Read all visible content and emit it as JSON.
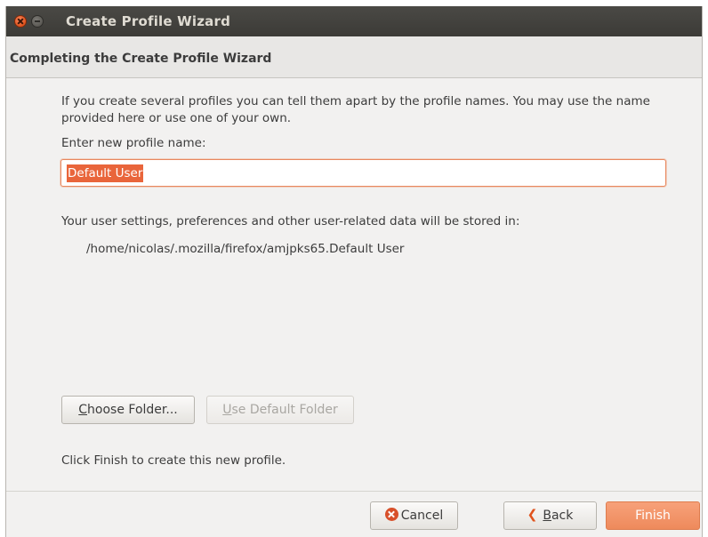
{
  "window": {
    "title": "Create Profile Wizard"
  },
  "header": {
    "title": "Completing the Create Profile Wizard"
  },
  "main": {
    "intro_text": "If you create several profiles you can tell them apart by the profile names. You may use the name provided here or use one of your own.",
    "profile_name_label": "Enter new profile name:",
    "profile_name_value": "Default User",
    "storage_text": "Your user settings, preferences and other user-related data will be stored in:",
    "storage_path": "/home/nicolas/.mozilla/firefox/amjpks65.Default User",
    "choose_folder_mnemonic": "C",
    "choose_folder_rest": "hoose Folder...",
    "use_default_folder_mnemonic": "U",
    "use_default_folder_rest": "se Default Folder",
    "finish_hint": "Click Finish to create this new profile."
  },
  "footer": {
    "cancel_label": "Cancel",
    "back_mnemonic": "B",
    "back_rest": "ack",
    "finish_label": "Finish"
  },
  "icons": {
    "close": "close-icon",
    "minimize": "minimize-icon",
    "cancel": "cancel-icon",
    "back": "back-arrow-icon"
  },
  "colors": {
    "titlebar": "#3c3b37",
    "accent": "#e9653b",
    "finish_button": "#f09264",
    "window_bg": "#f2f1f0"
  }
}
